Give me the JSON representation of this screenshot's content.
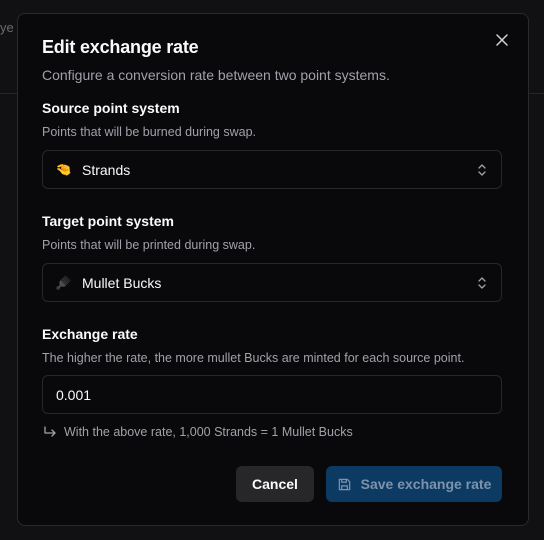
{
  "background": {
    "partial_text": "ye"
  },
  "dialog": {
    "title": "Edit exchange rate",
    "description": "Configure a conversion rate between two point systems.",
    "close_icon": "close-icon",
    "source": {
      "label": "Source point system",
      "help": "Points that will be burned during swap.",
      "emoji": "🤏",
      "value": "Strands"
    },
    "target": {
      "label": "Target point system",
      "help": "Points that will be printed during swap.",
      "emoji": "🪮",
      "value": "Mullet Bucks"
    },
    "rate": {
      "label": "Exchange rate",
      "help": "The higher the rate, the more mullet Bucks are minted for each source point.",
      "value": "0.001",
      "note": "With the above rate, 1,000 Strands = 1 Mullet Bucks"
    },
    "buttons": {
      "cancel": "Cancel",
      "save": "Save exchange rate"
    }
  },
  "colors": {
    "dialog_bg": "#09090b",
    "border": "#27272a",
    "save_bg": "#0d3a63",
    "muted_text": "#a1a1aa"
  }
}
